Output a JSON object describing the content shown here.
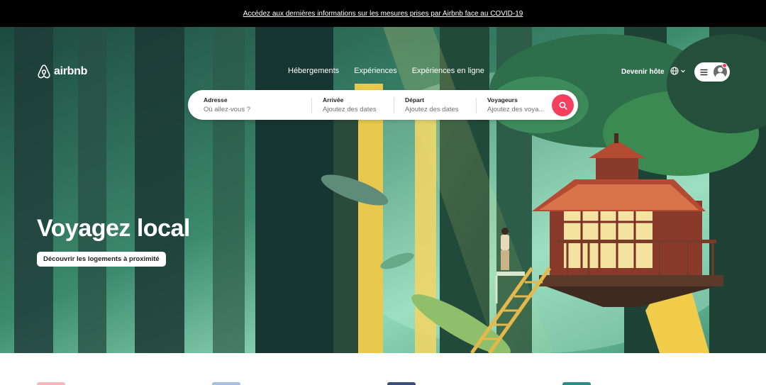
{
  "announcement": {
    "text": "Accédez aux dernières informations sur les mesures prises par Airbnb face au COVID-19"
  },
  "header": {
    "logo_text": "airbnb",
    "logo_icon": "airbnb-belo-icon",
    "tabs": [
      {
        "label": "Hébergements"
      },
      {
        "label": "Expériences"
      },
      {
        "label": "Expériences en ligne"
      }
    ],
    "host_label": "Devenir hôte",
    "globe_icon": "globe-icon",
    "menu_icon": "hamburger-icon",
    "avatar_icon": "user-avatar-icon"
  },
  "search": {
    "fields": [
      {
        "label": "Adresse",
        "placeholder": "Où allez-vous ?"
      },
      {
        "label": "Arrivée",
        "placeholder": "Ajoutez des dates"
      },
      {
        "label": "Départ",
        "placeholder": "Ajoutez des dates"
      },
      {
        "label": "Voyageurs",
        "placeholder": "Ajoutez des voya..."
      }
    ],
    "button_icon": "search-icon"
  },
  "hero": {
    "title": "Voyagez local",
    "cta": "Découvrir les logements à proximité"
  },
  "colors": {
    "brand": "#ff385c",
    "search_button": "#f43f5e",
    "announcement_bg": "#000000"
  }
}
